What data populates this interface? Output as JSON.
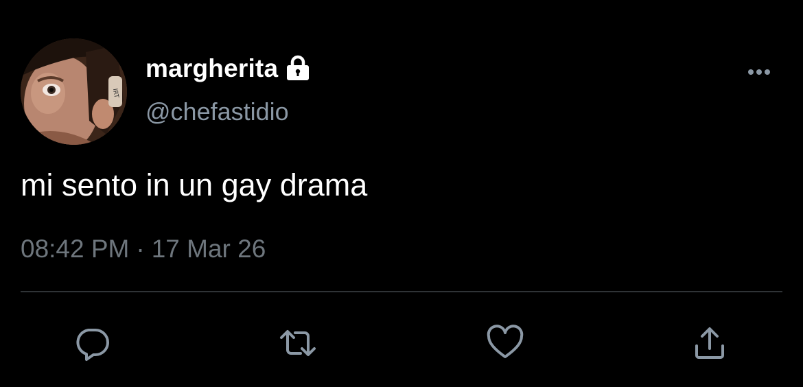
{
  "user": {
    "display_name": "margherita",
    "handle": "@chefastidio",
    "protected_icon": "lock-icon"
  },
  "tweet": {
    "text": "mi sento in un gay drama",
    "time": "08:42 PM",
    "separator": "·",
    "date": "17 Mar 26"
  },
  "actions": [
    {
      "icon": "reply-icon"
    },
    {
      "icon": "retweet-icon"
    },
    {
      "icon": "like-icon"
    },
    {
      "icon": "share-icon"
    }
  ],
  "menu": {
    "icon": "more-options-icon"
  },
  "colors": {
    "background": "#000000",
    "primary_text": "#ffffff",
    "secondary_text": "#8b98a5",
    "meta_text": "#6e767d",
    "icon": "#8b98a5",
    "divider": "#2f3336"
  }
}
